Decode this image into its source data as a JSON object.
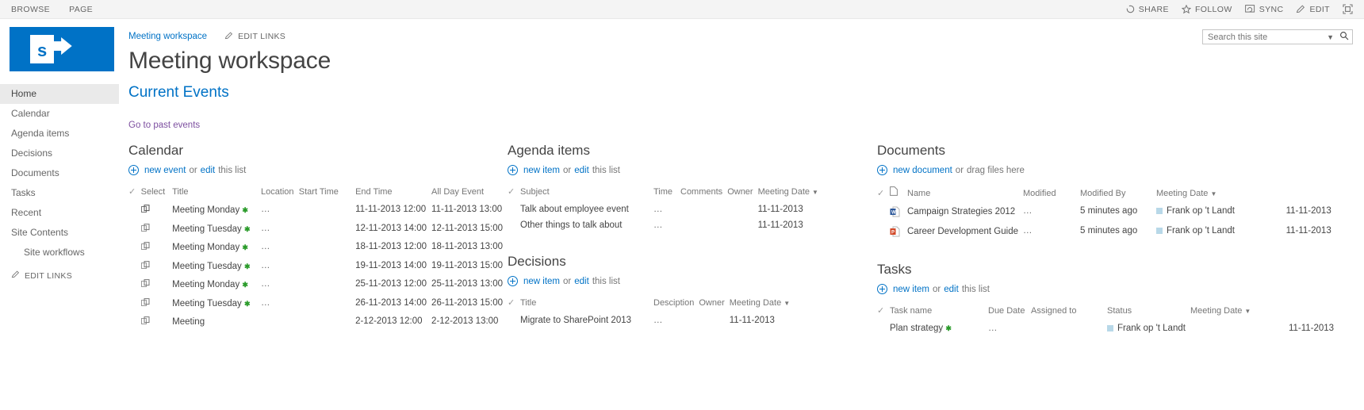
{
  "ribbon": {
    "tabs": [
      "BROWSE",
      "PAGE"
    ],
    "actions": [
      {
        "label": "SHARE",
        "icon": "share-icon"
      },
      {
        "label": "FOLLOW",
        "icon": "star-icon"
      },
      {
        "label": "SYNC",
        "icon": "sync-icon"
      },
      {
        "label": "EDIT",
        "icon": "pencil-icon"
      }
    ],
    "focus_label": "FOCUS ON CONTENT"
  },
  "header": {
    "breadcrumb": "Meeting workspace",
    "edit_links": "EDIT LINKS",
    "title": "Meeting workspace",
    "logo_letter": "s"
  },
  "search": {
    "placeholder": "Search this site",
    "value": ""
  },
  "sidebar": {
    "items": [
      {
        "label": "Home",
        "selected": true,
        "child": false
      },
      {
        "label": "Calendar",
        "selected": false,
        "child": false
      },
      {
        "label": "Agenda items",
        "selected": false,
        "child": false
      },
      {
        "label": "Decisions",
        "selected": false,
        "child": false
      },
      {
        "label": "Documents",
        "selected": false,
        "child": false
      },
      {
        "label": "Tasks",
        "selected": false,
        "child": false
      },
      {
        "label": "Recent",
        "selected": false,
        "child": false
      },
      {
        "label": "Site Contents",
        "selected": false,
        "child": false
      },
      {
        "label": "Site workflows",
        "selected": false,
        "child": true
      }
    ],
    "edit_links": "EDIT LINKS"
  },
  "page": {
    "heading": "Current Events",
    "past_events_link": "Go to past events"
  },
  "calendar": {
    "title": "Calendar",
    "action_new": "new event",
    "action_or": "or",
    "action_edit": "edit",
    "action_suffix": "this list",
    "columns": [
      "Select",
      "Title",
      "Location",
      "Start Time",
      "End Time",
      "All Day Event"
    ],
    "rows": [
      {
        "title": "Meeting Monday",
        "location": "",
        "start": "11-11-2013 12:00",
        "end": "11-11-2013 13:00",
        "allday": "",
        "new": true
      },
      {
        "title": "Meeting Tuesday",
        "location": "",
        "start": "12-11-2013 14:00",
        "end": "12-11-2013 15:00",
        "allday": "",
        "new": true
      },
      {
        "title": "Meeting Monday",
        "location": "",
        "start": "18-11-2013 12:00",
        "end": "18-11-2013 13:00",
        "allday": "",
        "new": true
      },
      {
        "title": "Meeting Tuesday",
        "location": "",
        "start": "19-11-2013 14:00",
        "end": "19-11-2013 15:00",
        "allday": "",
        "new": true
      },
      {
        "title": "Meeting Monday",
        "location": "",
        "start": "25-11-2013 12:00",
        "end": "25-11-2013 13:00",
        "allday": "",
        "new": true
      },
      {
        "title": "Meeting Tuesday",
        "location": "",
        "start": "26-11-2013 14:00",
        "end": "26-11-2013 15:00",
        "allday": "",
        "new": true
      },
      {
        "title": "Meeting",
        "location": "",
        "start": "2-12-2013 12:00",
        "end": "2-12-2013 13:00",
        "allday": "",
        "new": false
      }
    ]
  },
  "agenda": {
    "title": "Agenda items",
    "action_new": "new item",
    "action_or": "or",
    "action_edit": "edit",
    "action_suffix": "this list",
    "columns": [
      "Subject",
      "Time",
      "Comments",
      "Owner",
      "Meeting Date"
    ],
    "rows": [
      {
        "subject": "Talk about employee event",
        "time": "",
        "comments": "",
        "owner": "",
        "meeting_date": "11-11-2013"
      },
      {
        "subject": "Other things to talk about",
        "time": "",
        "comments": "",
        "owner": "",
        "meeting_date": "11-11-2013"
      }
    ]
  },
  "decisions": {
    "title": "Decisions",
    "action_new": "new item",
    "action_or": "or",
    "action_edit": "edit",
    "action_suffix": "this list",
    "columns": [
      "Title",
      "Desciption",
      "Owner",
      "Meeting Date"
    ],
    "rows": [
      {
        "title": "Migrate to SharePoint 2013",
        "description": "",
        "owner": "",
        "meeting_date": "11-11-2013"
      }
    ]
  },
  "documents": {
    "title": "Documents",
    "action_new": "new document",
    "action_or": "or",
    "action_suffix": "drag files here",
    "columns": [
      "Name",
      "Modified",
      "Modified By",
      "Meeting Date"
    ],
    "rows": [
      {
        "name": "Campaign Strategies 2012",
        "icon": "word-file-icon",
        "modified": "5 minutes ago",
        "modified_by": "Frank op 't Landt",
        "meeting_date": "11-11-2013"
      },
      {
        "name": "Career Development Guide",
        "icon": "powerpoint-file-icon",
        "modified": "5 minutes ago",
        "modified_by": "Frank op 't Landt",
        "meeting_date": "11-11-2013"
      }
    ]
  },
  "tasks": {
    "title": "Tasks",
    "action_new": "new item",
    "action_or": "or",
    "action_edit": "edit",
    "action_suffix": "this list",
    "columns": [
      "Task name",
      "Due Date",
      "Assigned to",
      "Status",
      "Meeting Date"
    ],
    "rows": [
      {
        "task_name": "Plan strategy",
        "due_date": "",
        "assigned_to": "Frank op 't Landt",
        "status": "",
        "meeting_date": "11-11-2013",
        "new": true
      }
    ]
  },
  "colors": {
    "brand": "#0072c6",
    "visited_link": "#7d4fa0",
    "new_badge": "#2a9b2a"
  }
}
